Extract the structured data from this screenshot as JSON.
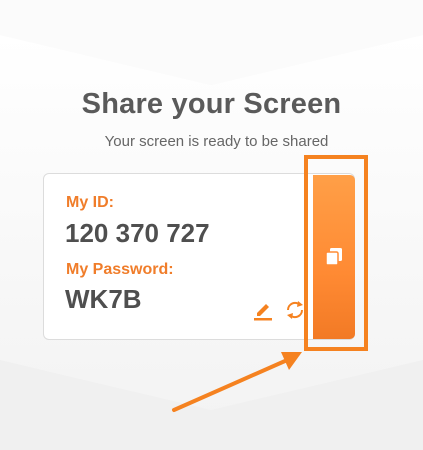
{
  "page": {
    "title": "Share your Screen",
    "subtitle": "Your screen is ready to be shared"
  },
  "credentials": {
    "id_label": "My ID:",
    "id_value": "120 370 727",
    "password_label": "My Password:",
    "password_value": "WK7B"
  },
  "icons": {
    "edit": "pencil-icon",
    "refresh": "refresh-icon",
    "copy": "copy-icon"
  },
  "colors": {
    "accent": "#f58220",
    "title_text": "#5a5a5a",
    "value_text": "#4f4f4f"
  }
}
